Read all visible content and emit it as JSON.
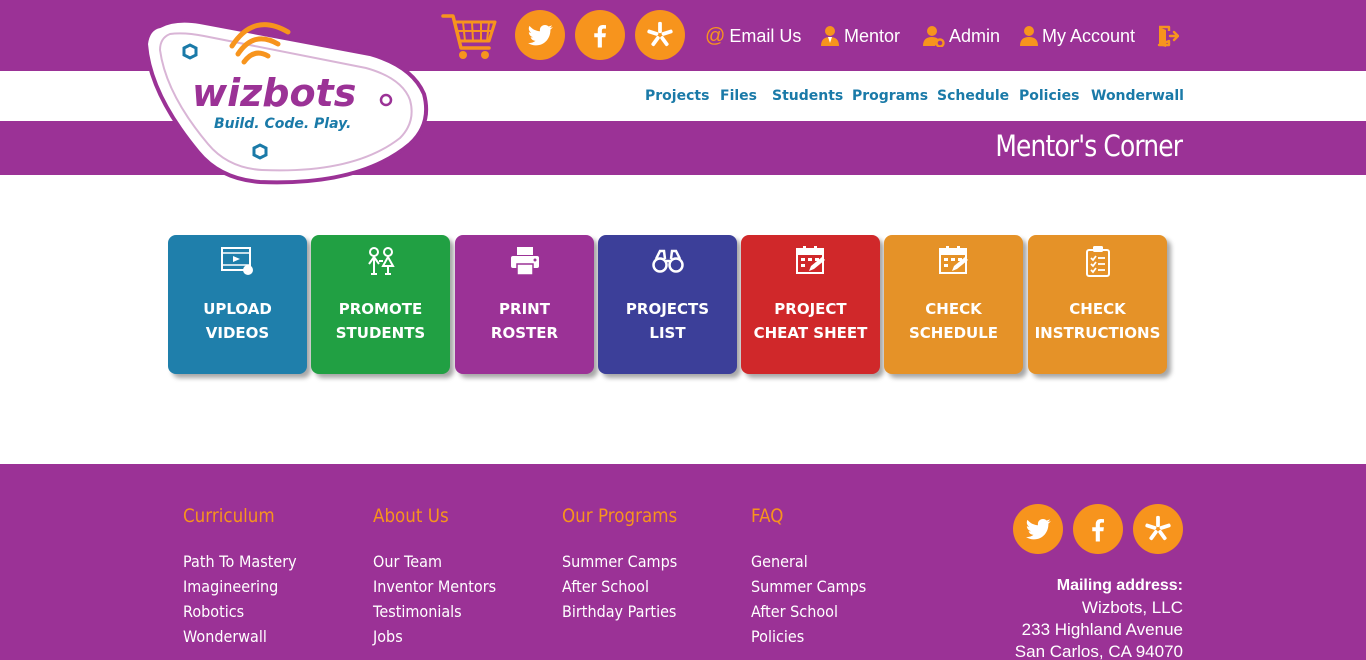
{
  "brand": {
    "logo_text": "wizbots",
    "tagline": "Build. Code. Play.",
    "purple": "#9b3296",
    "orange": "#f7941d",
    "nav_blue": "#1a7aa8"
  },
  "header": {
    "email_label": "Email Us",
    "mentor_label": "Mentor",
    "admin_label": "Admin",
    "account_label": "My Account"
  },
  "nav": {
    "items": [
      "Projects",
      "Files",
      "Students",
      "Programs",
      "Schedule",
      "Policies",
      "Wonderwall"
    ]
  },
  "page": {
    "title": "Mentor's Corner"
  },
  "tiles": [
    {
      "line1": "UPLOAD",
      "line2": "VIDEOS",
      "icon": "video-icon",
      "color": "#1f7fab"
    },
    {
      "line1": "PROMOTE",
      "line2": "STUDENTS",
      "icon": "students-icon",
      "color": "#21a043"
    },
    {
      "line1": "PRINT",
      "line2": "ROSTER",
      "icon": "printer-icon",
      "color": "#9b3296"
    },
    {
      "line1": "PROJECTS",
      "line2": "LIST",
      "icon": "binoculars-icon",
      "color": "#3c3f99"
    },
    {
      "line1": "PROJECT",
      "line2": "CHEAT SHEET",
      "icon": "calendar-edit-icon",
      "color": "#d0282a"
    },
    {
      "line1": "CHECK",
      "line2": "SCHEDULE",
      "icon": "calendar-icon",
      "color": "#e59228"
    },
    {
      "line1": "CHECK",
      "line2": "INSTRUCTIONS",
      "icon": "clipboard-icon",
      "color": "#e59228"
    }
  ],
  "footer": {
    "columns": [
      {
        "heading": "Curriculum",
        "links": [
          "Path To Mastery",
          "Imagineering",
          "Robotics",
          "Wonderwall"
        ]
      },
      {
        "heading": "About Us",
        "links": [
          "Our Team",
          "Inventor Mentors",
          "Testimonials",
          "Jobs"
        ]
      },
      {
        "heading": "Our Programs",
        "links": [
          "Summer Camps",
          "After School",
          "Birthday Parties"
        ]
      },
      {
        "heading": "FAQ",
        "links": [
          "General",
          "Summer Camps",
          "After School",
          "Policies"
        ]
      }
    ],
    "mailing": {
      "heading": "Mailing address:",
      "line1": "Wizbots, LLC",
      "line2": "233 Highland Avenue",
      "line3": "San Carlos, CA 94070"
    }
  }
}
